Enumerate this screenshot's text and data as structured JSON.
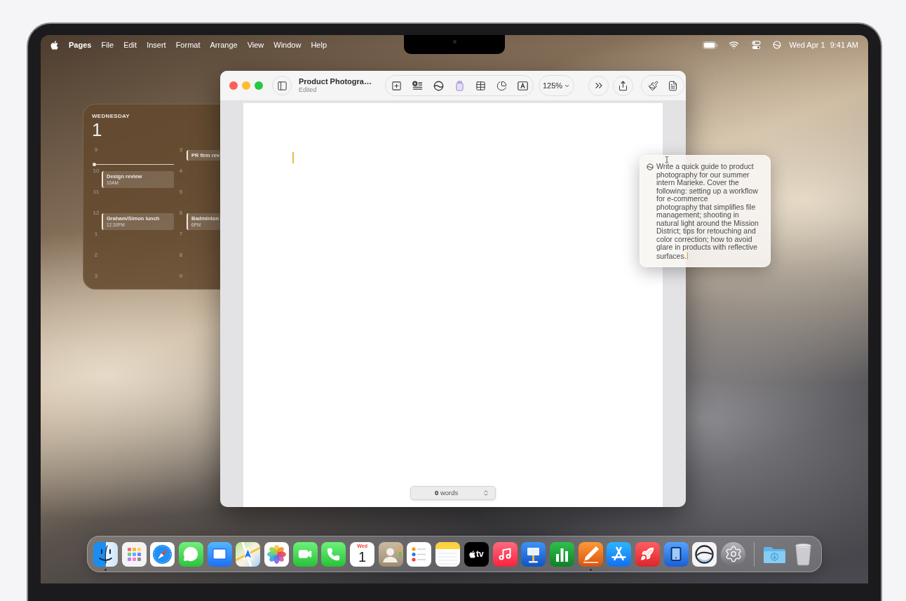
{
  "menu_bar": {
    "app_name": "Pages",
    "menus": [
      "File",
      "Edit",
      "Insert",
      "Format",
      "Arrange",
      "View",
      "Window",
      "Help"
    ],
    "date": "Wed Apr 1",
    "time": "9:41 AM"
  },
  "calendar_widget": {
    "weekday": "WEDNESDAY",
    "day": "1",
    "columns": [
      {
        "hours": [
          {
            "label": "9",
            "now": true
          },
          {
            "label": "10",
            "now": false,
            "event": {
              "title": "Design review",
              "time": "10AM"
            }
          },
          {
            "label": "11",
            "now": false
          },
          {
            "label": "12",
            "now": false,
            "event": {
              "title": "Graham/Simon lunch",
              "time": "12:30PM"
            }
          },
          {
            "label": "1",
            "now": false
          },
          {
            "label": "2",
            "now": false
          },
          {
            "label": "3",
            "now": false
          }
        ]
      },
      {
        "hours": [
          {
            "label": "3",
            "now": false,
            "event": {
              "title": "PR firm rev"
            }
          },
          {
            "label": "4",
            "now": false
          },
          {
            "label": "5",
            "now": false
          },
          {
            "label": "6",
            "now": false,
            "event": {
              "title": "Badminton",
              "time": "6PM"
            }
          },
          {
            "label": "7",
            "now": false
          },
          {
            "label": "8",
            "now": false
          },
          {
            "label": "9",
            "now": false
          }
        ]
      }
    ]
  },
  "pages_window": {
    "title": "Product Photogra…",
    "subtitle": "Edited",
    "zoom": "125%",
    "word_count": "**0** words"
  },
  "prompt_popup": {
    "text": "Write a quick guide to product photography for our summer intern Marieke. Cover the following: setting up a workflow for e-commerce\nphotography that simplifies file management; shooting in natural light around the Mission District; tips for retouching and color correction; how to avoid glare in products with reflective surfaces."
  },
  "dock": {
    "apps": [
      {
        "kind": "finder",
        "running": true
      },
      {
        "kind": "launchpad",
        "running": false
      },
      {
        "kind": "safari",
        "running": false
      },
      {
        "kind": "messages",
        "running": false
      },
      {
        "kind": "mail",
        "running": false
      },
      {
        "kind": "maps",
        "running": false
      },
      {
        "kind": "photos",
        "running": false
      },
      {
        "kind": "facetime",
        "running": false
      },
      {
        "kind": "phone",
        "running": false
      },
      {
        "kind": "calendar",
        "weekday": "Wed",
        "day": "1",
        "running": false
      },
      {
        "kind": "contacts",
        "running": false
      },
      {
        "kind": "reminders",
        "running": false
      },
      {
        "kind": "notes",
        "running": false
      },
      {
        "kind": "tv",
        "label": "tv",
        "running": false
      },
      {
        "kind": "music",
        "running": false
      },
      {
        "kind": "keynote",
        "running": false
      },
      {
        "kind": "numbers",
        "running": false
      },
      {
        "kind": "pages",
        "running": true
      },
      {
        "kind": "appstore",
        "running": false
      },
      {
        "kind": "rocket",
        "running": false
      },
      {
        "kind": "device",
        "running": false
      },
      {
        "kind": "ring",
        "running": false
      },
      {
        "kind": "settings",
        "running": false
      }
    ],
    "stacks": [
      {
        "kind": "downloads"
      },
      {
        "kind": "trash"
      }
    ]
  }
}
